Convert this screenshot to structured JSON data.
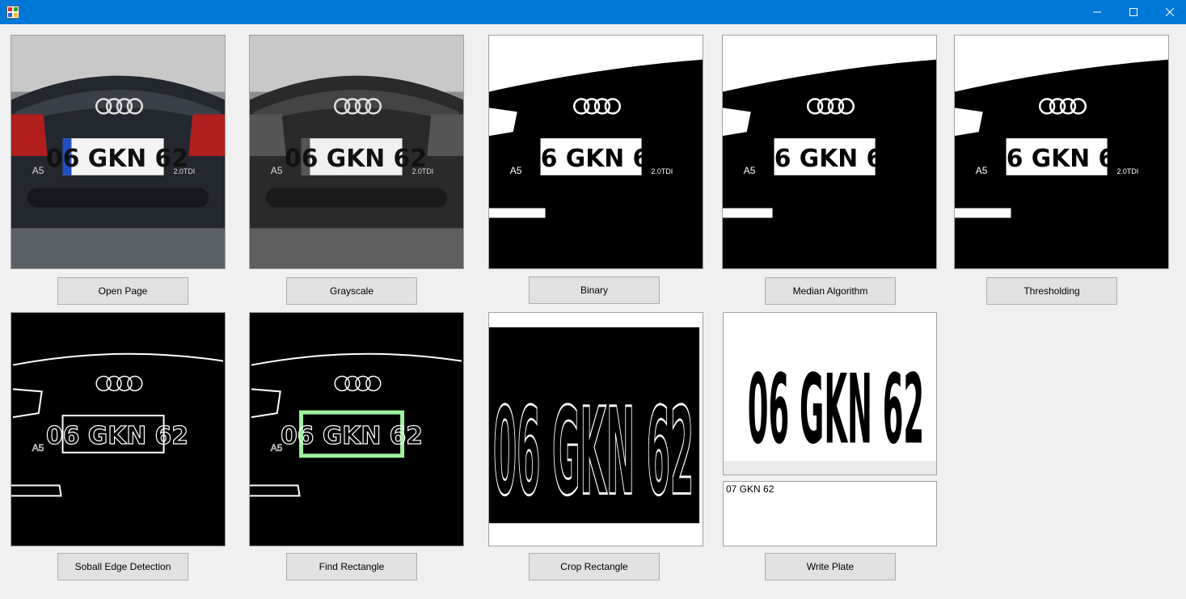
{
  "window": {
    "minimize_icon": "minimize-icon",
    "maximize_icon": "maximize-icon",
    "close_icon": "close-icon",
    "title_bar_color": "#0078d7"
  },
  "images": {
    "plate_text": "06 GKN 62",
    "model_badge": "A5",
    "engine_badge": "2.0TDI",
    "found_rectangle_color": "#a0f0a0"
  },
  "buttons": {
    "open_page": "Open Page",
    "grayscale": "Grayscale",
    "binary": "Binary",
    "median": "Median Algorithm",
    "thresholding": "Thresholding",
    "edge": "Soball Edge Detection",
    "find_rect": "Find Rectangle",
    "crop_rect": "Crop Rectangle",
    "write_plate": "Write Plate"
  },
  "output": {
    "plate_result": "07 GKN 62"
  }
}
